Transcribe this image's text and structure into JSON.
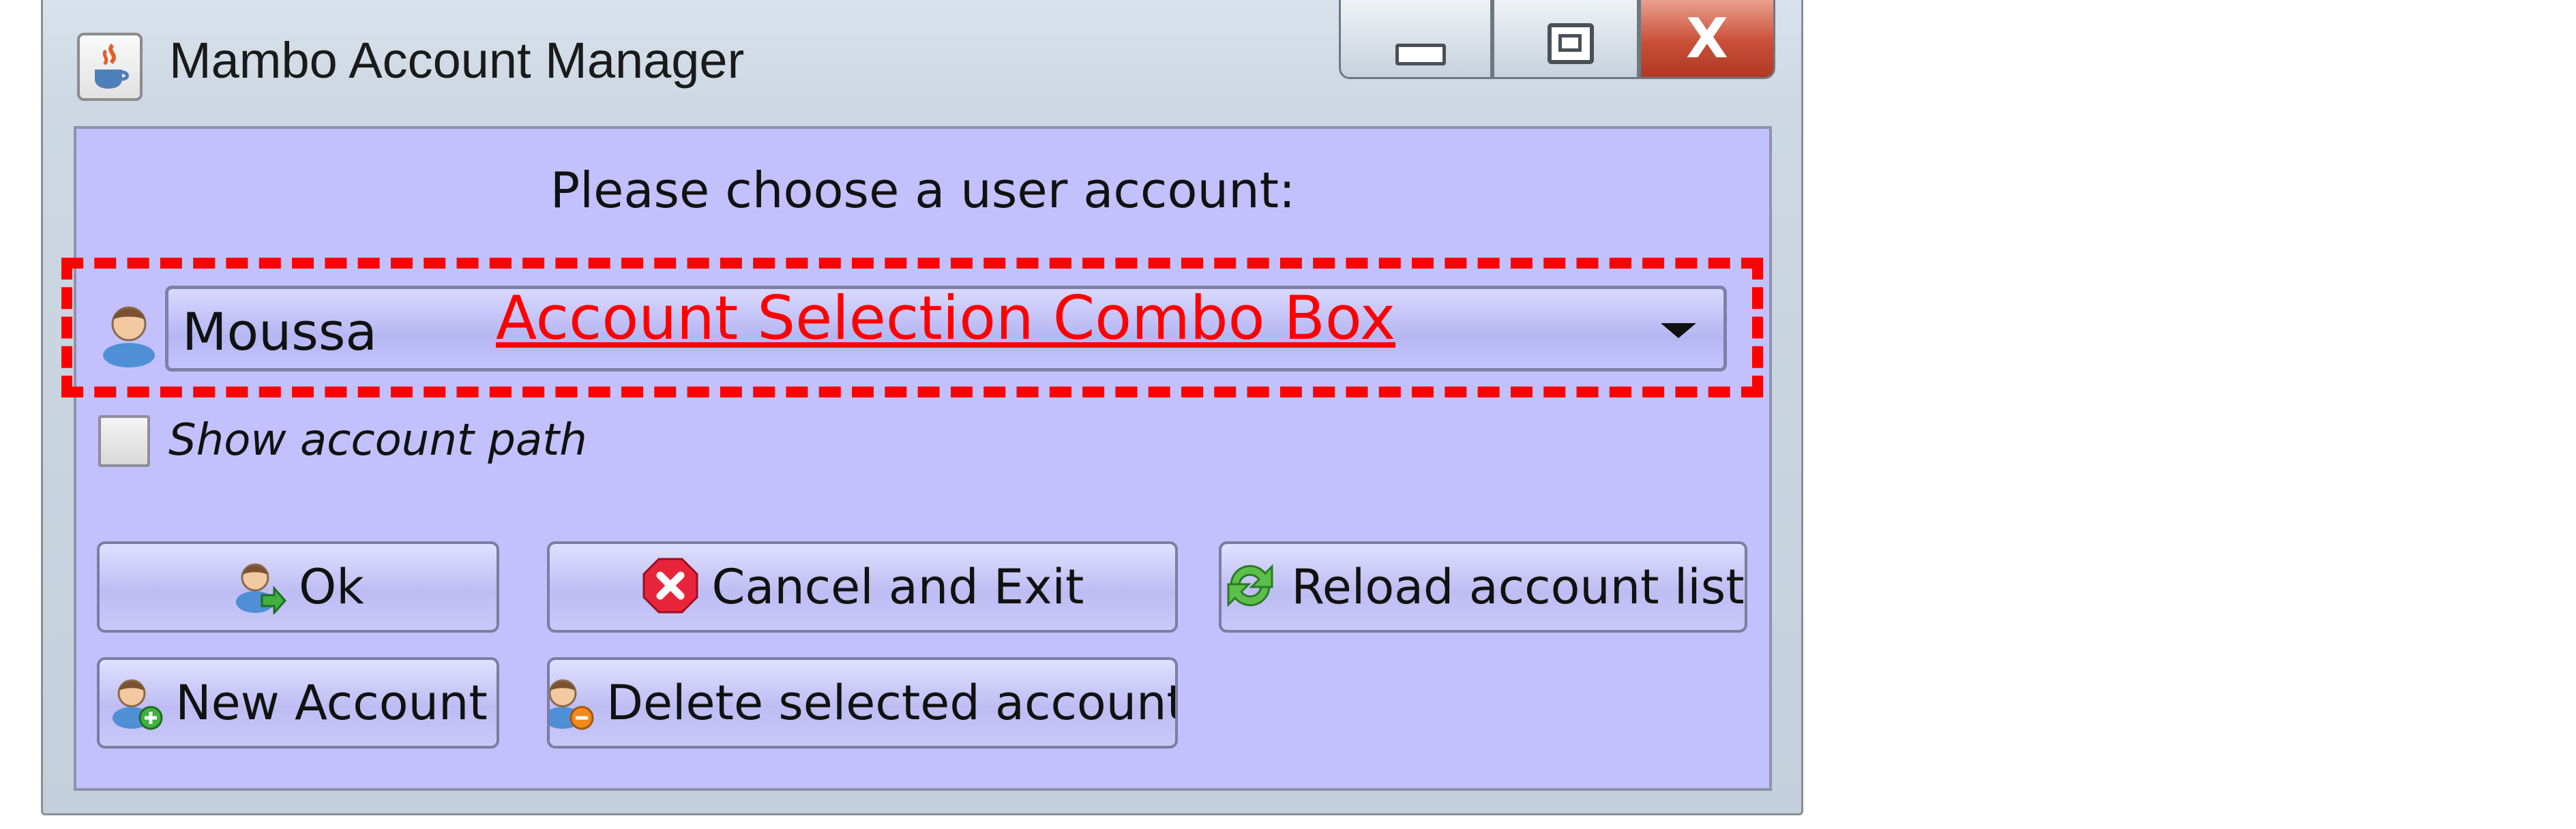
{
  "window": {
    "title": "Mambo Account Manager",
    "title_icon": "java-cup-icon",
    "controls": {
      "minimize": "minimize-icon",
      "maximize": "maximize-icon",
      "close_glyph": "X"
    }
  },
  "prompt": "Please choose a user account:",
  "account_combo": {
    "selected": "Moussa",
    "icon": "user-icon",
    "annotation": "Account Selection Combo Box"
  },
  "show_path": {
    "label": "Show account path",
    "checked": false
  },
  "buttons": [
    {
      "label": "Ok",
      "icon": "user-arrow-icon"
    },
    {
      "label": "Cancel and Exit",
      "icon": "cancel-icon"
    },
    {
      "label": "Reload account list",
      "icon": "reload-icon"
    },
    {
      "label": "New Account",
      "icon": "user-add-icon"
    },
    {
      "label": "Delete selected account",
      "icon": "user-delete-icon"
    }
  ],
  "colors": {
    "panel_bg": "#c2c1fe",
    "annotation": "#ff0000",
    "close_button": "#c94e37"
  }
}
